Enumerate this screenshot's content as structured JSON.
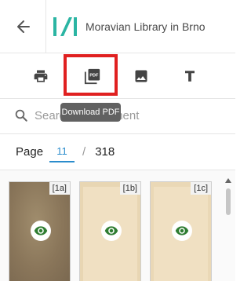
{
  "header": {
    "library_name": "Moravian Library in Brno",
    "logo_color": "#2bb5a3"
  },
  "toolbar": {
    "tools": [
      {
        "name": "print",
        "icon": "print-icon"
      },
      {
        "name": "download-pdf",
        "icon": "pdf-icon",
        "icon_text": "PDF",
        "highlighted": true
      },
      {
        "name": "image",
        "icon": "image-icon"
      },
      {
        "name": "text",
        "icon": "text-icon"
      }
    ],
    "highlight_color": "#e02020"
  },
  "tooltip": {
    "text": "Download PDF"
  },
  "search": {
    "placeholder": "Search in document"
  },
  "pager": {
    "label": "Page",
    "current": "11",
    "separator": "/",
    "total": "318",
    "accent_color": "#2a8ccc"
  },
  "thumbnails": [
    {
      "label": "[1a]"
    },
    {
      "label": "[1b]"
    },
    {
      "label": "[1c]"
    }
  ],
  "eye_color": "#2f7d32"
}
